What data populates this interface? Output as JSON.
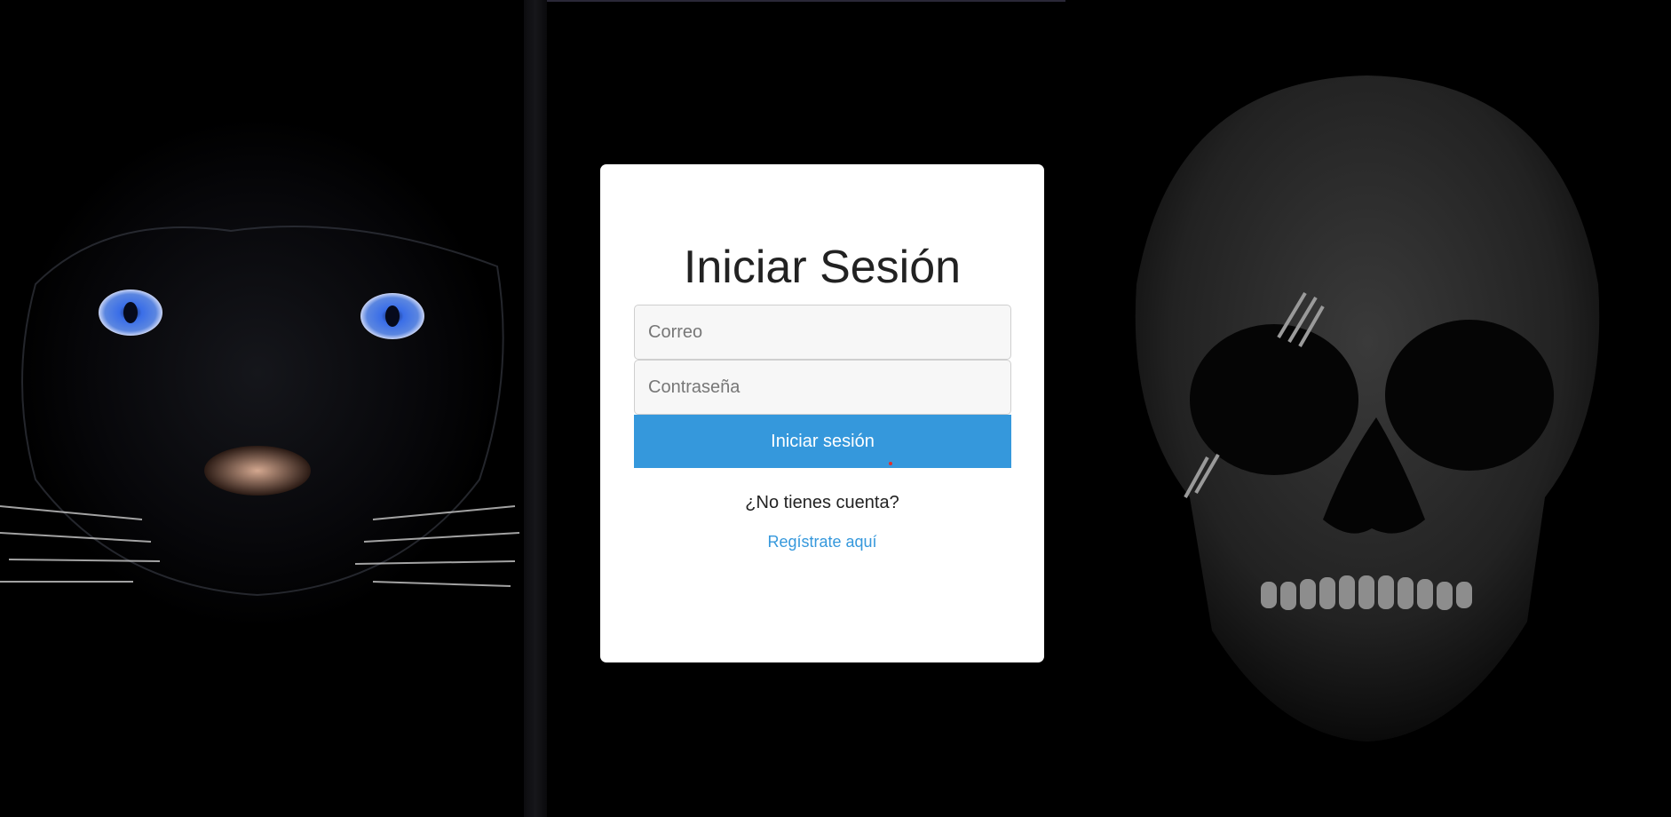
{
  "page": {
    "title": "Iniciar Sesión"
  },
  "form": {
    "email_placeholder": "Correo",
    "password_placeholder": "Contraseña",
    "submit_label": "Iniciar sesión"
  },
  "footer": {
    "no_account_text": "¿No tienes cuenta?",
    "register_link": "Regístrate aquí"
  },
  "colors": {
    "accent": "#3598dc",
    "background": "#000000",
    "card": "#ffffff"
  },
  "icons": {
    "background_left": "panther-face-artwork",
    "background_right": "skull-artwork"
  }
}
